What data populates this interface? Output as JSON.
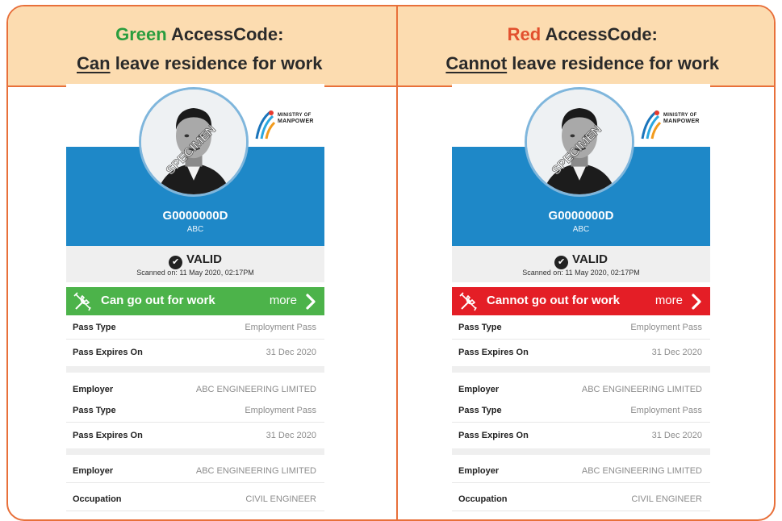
{
  "header": {
    "left": {
      "color_word": "Green",
      "rest": " AccessCode:",
      "underlined": "Can",
      "line2_rest": " leave residence for work"
    },
    "right": {
      "color_word": "Red",
      "rest": " AccessCode:",
      "underlined": "Cannot",
      "line2_rest": " leave residence for work"
    }
  },
  "cards": {
    "left": {
      "logo_line1": "MINISTRY OF",
      "logo_line2": "MANPOWER",
      "fin": "G0000000D",
      "org": "ABC",
      "valid": "VALID",
      "scanned": "Scanned on: 11 May 2020, 02:17PM",
      "status_label": "Can go out for work",
      "more": "more",
      "rows": [
        {
          "k": "Pass Type",
          "v": "Employment Pass"
        },
        {
          "k": "Pass Expires On",
          "v": "31 Dec 2020"
        },
        {
          "k": "Employer",
          "v": "ABC ENGINEERING LIMITED"
        },
        {
          "k": "Pass Type",
          "v": "Employment Pass"
        },
        {
          "k": "Pass Expires On",
          "v": "31 Dec 2020"
        },
        {
          "k": "Employer",
          "v": "ABC ENGINEERING LIMITED"
        },
        {
          "k": "Occupation",
          "v": "CIVIL ENGINEER"
        }
      ]
    },
    "right": {
      "logo_line1": "MINISTRY OF",
      "logo_line2": "MANPOWER",
      "fin": "G0000000D",
      "org": "ABC",
      "valid": "VALID",
      "scanned": "Scanned on: 11 May 2020, 02:17PM",
      "status_label": "Cannot go out for work",
      "more": "more",
      "rows": [
        {
          "k": "Pass Type",
          "v": "Employment Pass"
        },
        {
          "k": "Pass Expires On",
          "v": "31 Dec 2020"
        },
        {
          "k": "Employer",
          "v": "ABC ENGINEERING LIMITED"
        },
        {
          "k": "Pass Type",
          "v": "Employment Pass"
        },
        {
          "k": "Pass Expires On",
          "v": "31 Dec 2020"
        },
        {
          "k": "Employer",
          "v": "ABC ENGINEERING LIMITED"
        },
        {
          "k": "Occupation",
          "v": "CIVIL ENGINEER"
        }
      ]
    }
  },
  "photo_watermark": "SPECIMEN",
  "colors": {
    "accent": "#e8703a",
    "header_bg": "#fcdcb0",
    "blue": "#1e88c8",
    "green": "#4cb34a",
    "red": "#e41e26"
  }
}
